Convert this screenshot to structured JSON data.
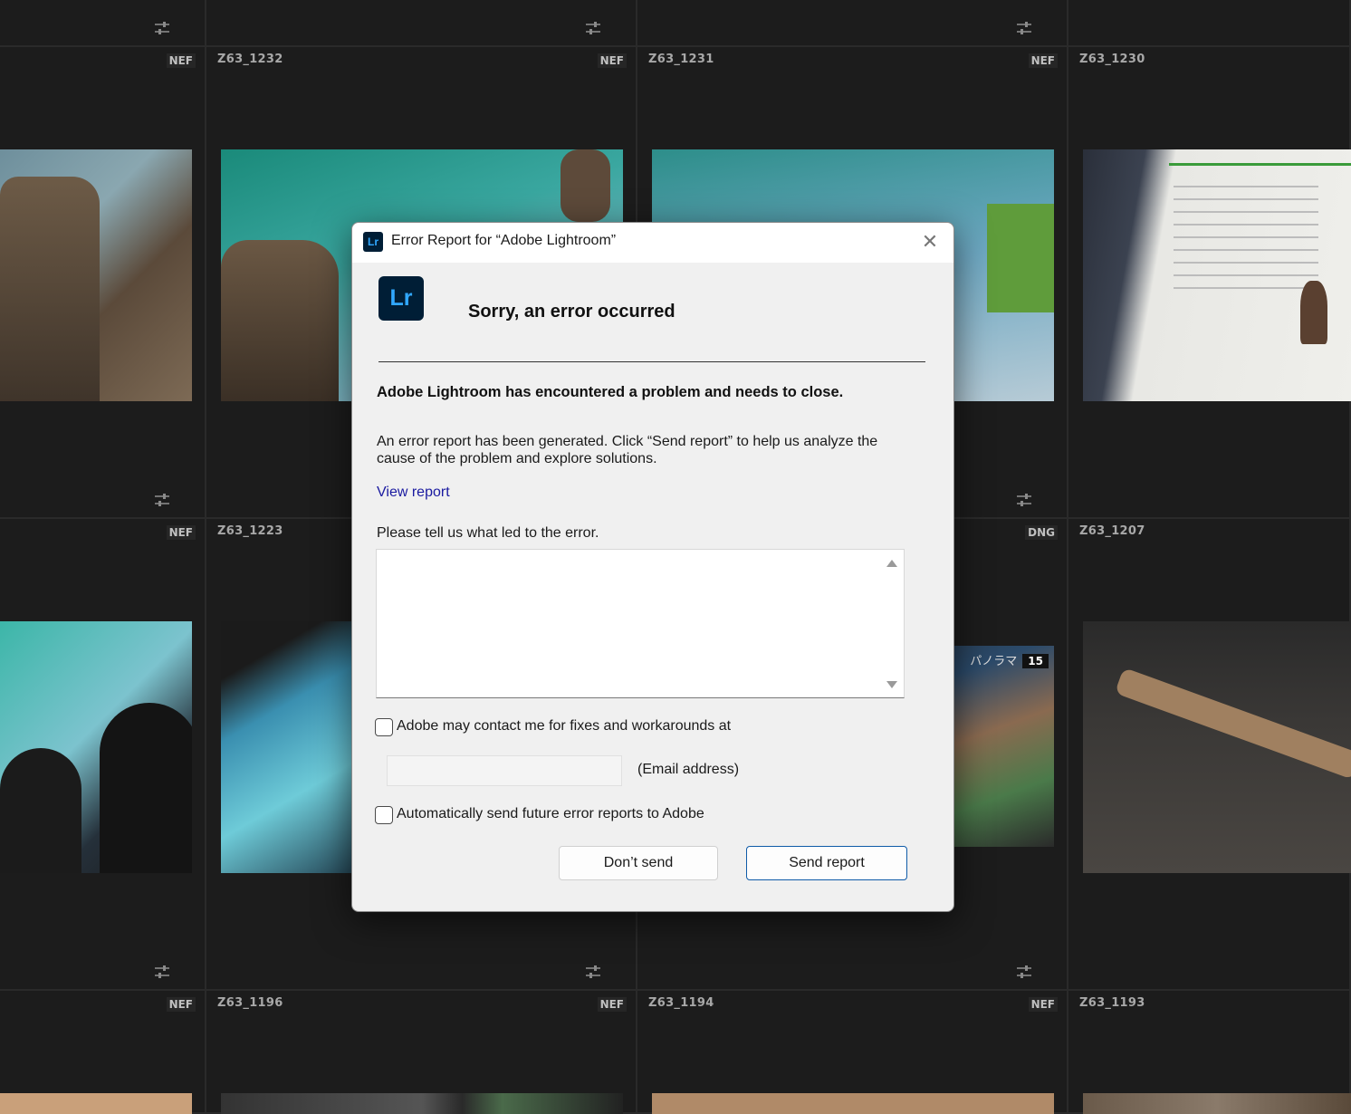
{
  "grid": {
    "cells": [
      {
        "filename": "",
        "filetype": "NEF"
      },
      {
        "filename": "Z63_1232",
        "filetype": "NEF"
      },
      {
        "filename": "Z63_1231",
        "filetype": "NEF"
      },
      {
        "filename": "Z63_1230",
        "filetype": ""
      },
      {
        "filename": "",
        "filetype": "NEF"
      },
      {
        "filename": "Z63_1223",
        "filetype": ""
      },
      {
        "filename": "",
        "filetype": "DNG"
      },
      {
        "filename": "Z63_1207",
        "filetype": ""
      },
      {
        "filename": "",
        "filetype": "NEF"
      },
      {
        "filename": "Z63_1196",
        "filetype": "NEF"
      },
      {
        "filename": "Z63_1194",
        "filetype": "NEF"
      },
      {
        "filename": "Z63_1193",
        "filetype": ""
      }
    ],
    "pano_badge": {
      "label": "パノラマ",
      "count": "15"
    }
  },
  "dialog": {
    "title": "Error Report for “Adobe Lightroom”",
    "logo_text": "Lr",
    "heading": "Sorry, an error occurred",
    "message_bold": "Adobe Lightroom has encountered a problem and needs to close.",
    "message_body": "An error report has been generated. Click “Send report” to help us analyze the cause of the problem and explore solutions.",
    "view_report_link": "View report",
    "prompt": "Please tell us what led to the error.",
    "description_value": "",
    "contact_checkbox": {
      "label": "Adobe may contact me for fixes and workarounds at",
      "checked": false
    },
    "email": {
      "value": "",
      "label": "(Email address)"
    },
    "auto_send_checkbox": {
      "label": "Automatically send future error reports to Adobe",
      "checked": false
    },
    "buttons": {
      "dont_send": "Don’t send",
      "send_report": "Send report"
    },
    "close_icon": "close-icon"
  },
  "colors": {
    "lightroom_dark": "#001e36",
    "lightroom_blue": "#31a8ff",
    "link": "#1a1aa0",
    "primary_border": "#0f5ba8"
  }
}
